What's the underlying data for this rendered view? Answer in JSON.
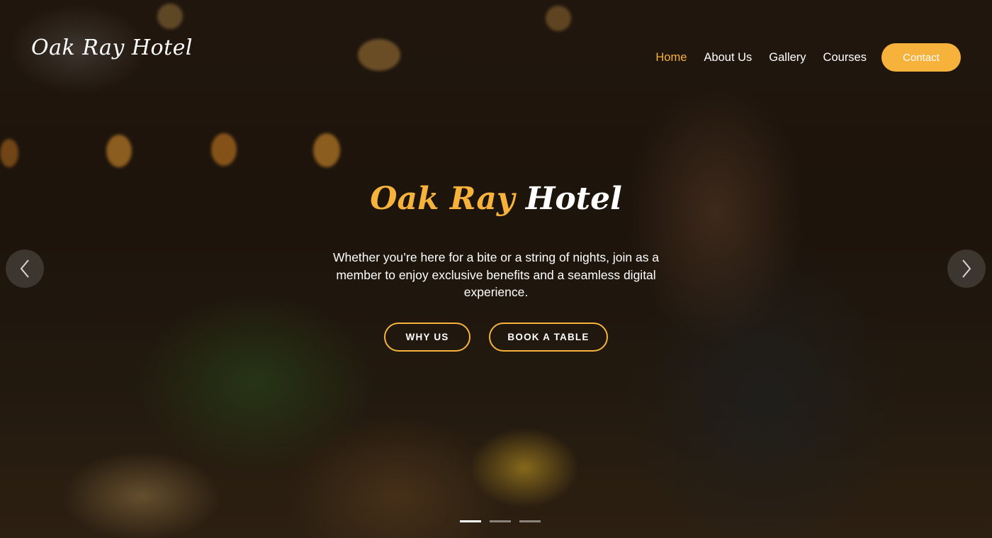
{
  "brand": {
    "logo_text": "Oak Ray Hotel"
  },
  "nav": {
    "items": [
      {
        "label": "Home",
        "active": true
      },
      {
        "label": "About Us",
        "active": false
      },
      {
        "label": "Gallery",
        "active": false
      },
      {
        "label": "Courses",
        "active": false
      }
    ],
    "contact_label": "Contact"
  },
  "hero": {
    "title_part1": "Oak Ray",
    "title_part2": "Hotel",
    "text": "Whether you’re here for a bite or a string of nights, join as a member to enjoy exclusive benefits and a seamless digital experience.",
    "buttons": {
      "why_us": "WHY US",
      "book_table": "BOOK A TABLE"
    }
  },
  "carousel": {
    "prev_icon": "chevron-left-icon",
    "next_icon": "chevron-right-icon",
    "slide_count": 3,
    "active_slide": 1
  },
  "colors": {
    "accent": "#f7b23b",
    "text": "#ffffff"
  }
}
